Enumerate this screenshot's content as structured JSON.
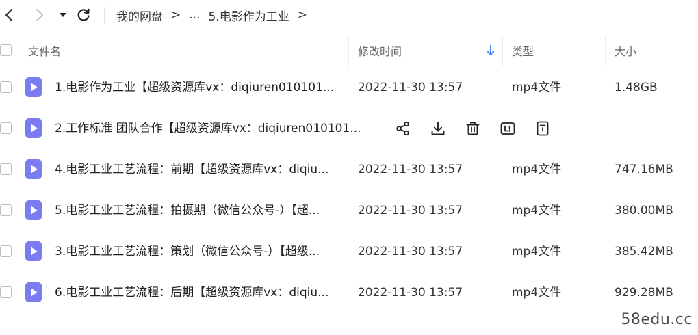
{
  "breadcrumb": {
    "root": "我的网盘",
    "sep1": ">",
    "ellipsis": "...",
    "current": "5.电影作为工业",
    "sep2": ">"
  },
  "table": {
    "headers": {
      "name": "文件名",
      "modified": "修改时间",
      "type": "类型",
      "size": "大小"
    },
    "sort": {
      "column": "modified",
      "direction": "descending"
    }
  },
  "files": [
    {
      "name": "1.电影作为工业【超级资源库vx：diqiuren010101...",
      "modified": "2022-11-30 13:57",
      "type": "mp4文件",
      "size": "1.48GB"
    },
    {
      "name": "2.工作标准  团队合作【超级资源库vx：diqiuren010101...",
      "modified": "",
      "type": "",
      "size": ""
    },
    {
      "name": "4.电影工业工艺流程：前期【超级资源库vx：diqiu...",
      "modified": "2022-11-30 13:57",
      "type": "mp4文件",
      "size": "747.16MB"
    },
    {
      "name": "5.电影工业工艺流程：拍摄期（微信公众号-）【超...",
      "modified": "2022-11-30 13:57",
      "type": "mp4文件",
      "size": "380.00MB"
    },
    {
      "name": "3.电影工业工艺流程：策划（微信公众号-）【超级...",
      "modified": "2022-11-30 13:57",
      "type": "mp4文件",
      "size": "385.42MB"
    },
    {
      "name": "6.电影工业工艺流程：后期【超级资源库vx：diqiu...",
      "modified": "2022-11-30 13:57",
      "type": "mp4文件",
      "size": "929.28MB"
    }
  ],
  "hover_actions": [
    "share-icon",
    "download-icon",
    "delete-icon",
    "rename-icon",
    "more-icon"
  ],
  "watermark": "58edu.cc",
  "colors": {
    "file_icon": "#7b7cf0",
    "sort_arrow": "#3b82f6",
    "text": "#222222",
    "header_text": "#666666"
  }
}
